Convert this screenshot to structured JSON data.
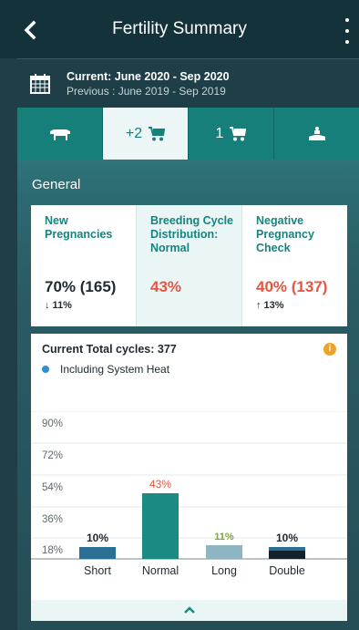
{
  "header": {
    "title": "Fertility Summary"
  },
  "dates": {
    "current": "Current: June 2020 - Sep 2020",
    "previous": "Previous : June 2019 - Sep 2019"
  },
  "tabs": [
    {
      "icon": "cow-icon",
      "label": ""
    },
    {
      "icon": "stroller-icon",
      "label": "+2"
    },
    {
      "icon": "stroller-icon",
      "label": "1"
    },
    {
      "icon": "calf-birth-icon",
      "label": ""
    }
  ],
  "general": {
    "label": "General",
    "kpis": [
      {
        "title": "New Pregnancies",
        "value": "70% (165)",
        "change": "↓ 11%"
      },
      {
        "title": "Breeding Cycle Distribution: Normal",
        "value": "43%",
        "change": ""
      },
      {
        "title": "Negative Pregnancy Check",
        "value": "40% (137)",
        "change": "↑ 13%"
      }
    ]
  },
  "cycles": {
    "total": "Current Total cycles: 377",
    "legend": "Including System Heat"
  },
  "chart_data": {
    "type": "bar",
    "categories": [
      "Short",
      "Normal",
      "Long",
      "Double"
    ],
    "values": [
      10,
      43,
      11,
      10
    ],
    "value_labels": [
      "10%",
      "43%",
      "11%",
      "10%"
    ],
    "label_colors": [
      "#1d2a30",
      "#e7553f",
      "#7fa43a",
      "#1d2a30"
    ],
    "bar_colors": [
      "#2b6f94",
      "#1a8a82",
      "#8fb4c2",
      "#13212b"
    ],
    "yticks": [
      "90%",
      "72%",
      "54%",
      "36%",
      "18%"
    ],
    "ytick_values": [
      90,
      72,
      54,
      36,
      18
    ],
    "ylim": [
      18,
      90
    ]
  },
  "colors": {
    "accent": "#167f7a",
    "negative": "#e7553f",
    "header_bg": "#14323a"
  }
}
